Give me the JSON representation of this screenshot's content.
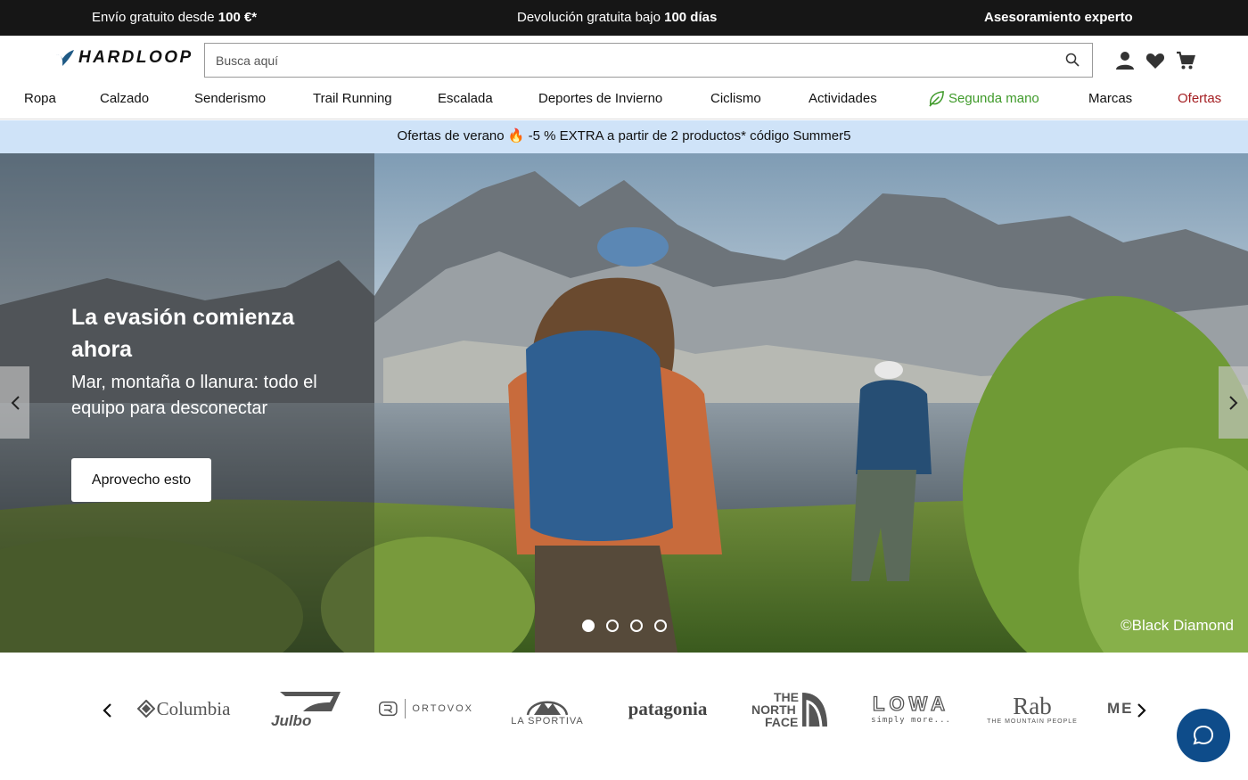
{
  "topbar": {
    "shipping_prefix": "Envío gratuito desde ",
    "shipping_bold": "100 €*",
    "returns_prefix": "Devolución gratuita bajo ",
    "returns_bold": "100 días",
    "advice": "Asesoramiento experto"
  },
  "header": {
    "logo_text": "HARDLOOP",
    "search_placeholder": "Busca aquí",
    "icons": [
      "user-icon",
      "heart-icon",
      "cart-icon"
    ]
  },
  "nav": {
    "items": [
      "Ropa",
      "Calzado",
      "Senderismo",
      "Trail Running",
      "Escalada",
      "Deportes de Invierno",
      "Ciclismo",
      "Actividades",
      "Segunda mano",
      "Marcas",
      "Ofertas"
    ]
  },
  "promo": {
    "text_before": "Ofertas de verano ",
    "emoji": "🔥",
    "text_after": " -5 % EXTRA a partir de 2 productos* código Summer5"
  },
  "hero": {
    "title": "La evasión comienza ahora",
    "subtitle": "Mar, montaña o llanura: todo el equipo para desconectar",
    "button": "Aprovecho esto",
    "credit": "©Black Diamond",
    "slide_count": 4,
    "active_slide": 1
  },
  "brands": {
    "columbia": "Columbia",
    "julbo": "Julbo",
    "ortovox": "ORTOVOX",
    "sportiva": "LA SPORTIVA",
    "patagonia": "patagonia",
    "tnf_line1": "THE",
    "tnf_line2": "NORTH",
    "tnf_line3": "FACE",
    "lowa": "LOWA",
    "lowa_tag": "simply more...",
    "rab": "Rab",
    "rab_tag": "THE MOUNTAIN PEOPLE",
    "mec": "MEC"
  },
  "colors": {
    "topbar_bg": "#161616",
    "promo_bg": "#cfe3f8",
    "second_hand_green": "#3f9a2a",
    "offers_red": "#a41e22",
    "chat_blue": "#0e4c8a"
  }
}
